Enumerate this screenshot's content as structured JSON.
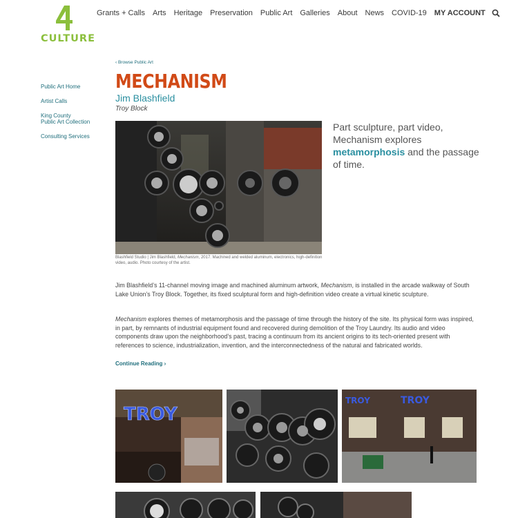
{
  "brand": {
    "logo_text": "CULTURE",
    "logo_glyph": "4",
    "color": "#8bbf3c"
  },
  "nav": {
    "items": [
      "Grants + Calls",
      "Arts",
      "Heritage",
      "Preservation",
      "Public Art",
      "Galleries",
      "About",
      "News",
      "COVID-19"
    ],
    "account": "MY ACCOUNT",
    "search_icon": "search-icon"
  },
  "sidebar": {
    "items": [
      "Public Art Home",
      "Artist Calls",
      "King County",
      "Public Art Collection",
      "Consulting Services"
    ]
  },
  "main": {
    "breadcrumb": "‹ Browse Public Art",
    "title": "MECHANISM",
    "artist": "Jim Blashfield",
    "location": "Troy Block",
    "caption_pre": "Blashfield Studio | Jim Blashfield, ",
    "caption_em": "Mechanism",
    "caption_post": ", 2017. Machined and welded aluminum, electronics, high-definition video, audio. Photo courtesy of the artist.",
    "pull_pre": "Part sculpture, part video, Mechanism explores ",
    "pull_highlight": "metamorphosis",
    "pull_post": " and the passage of time.",
    "p1_pre": "Jim Blashfield’s 11-channel moving image and machined aluminum artwork, ",
    "p1_em": "Mechanism",
    "p1_post": ", is installed in the arcade walkway of South Lake Union’s Troy Block. Together, its fixed sculptural form and high-definition video create a virtual kinetic sculpture.",
    "p2_em": "Mechanism",
    "p2_post": " explores themes of metamorphosis and the passage of time through the history of the site. Its physical form was inspired, in part, by remnants of industrial equipment found and recovered during demolition of the Troy Laundry. Its audio and video components draw upon the neighborhood’s past, tracing a continuum from its ancient origins to its tech-oriented present with references to science, industrialization, invention, and the interconnectedness of the natural and fabricated worlds.",
    "continue": "Continue Reading ›"
  },
  "gallery": {
    "sign_text": "TROY"
  },
  "colors": {
    "accent_orange": "#d14a17",
    "accent_teal": "#2a8fa0",
    "link": "#1f6e7c"
  }
}
